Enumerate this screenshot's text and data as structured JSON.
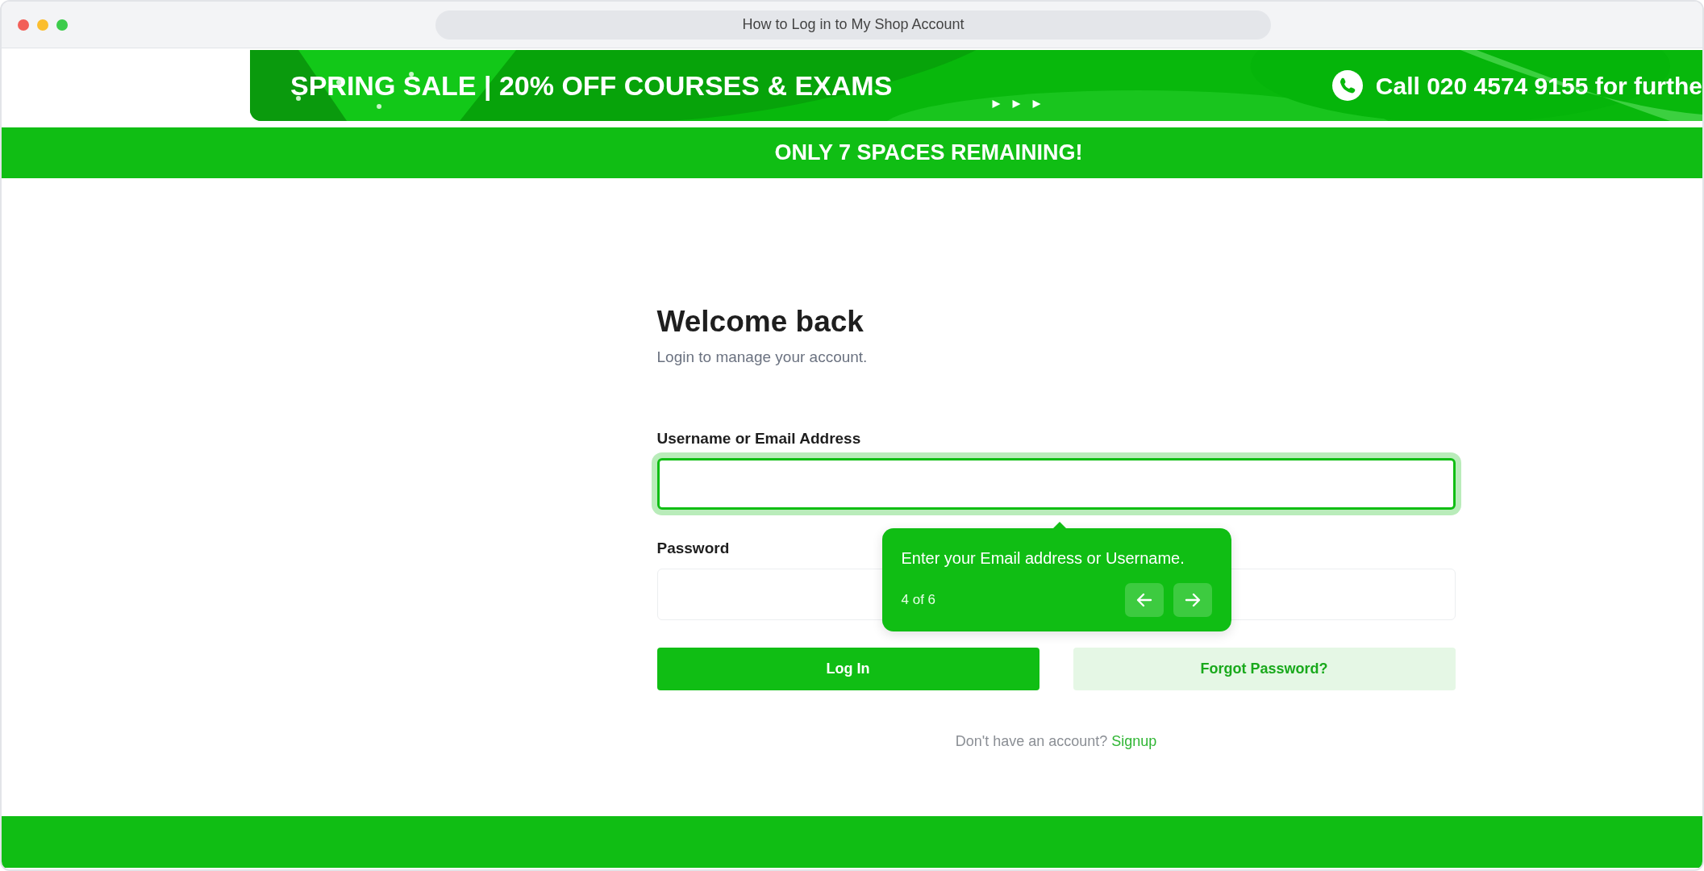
{
  "window": {
    "title": "How to Log in to My Shop Account"
  },
  "banner": {
    "headline": "SPRING SALE | 20% OFF COURSES & EXAMS",
    "phone_text": "Call 020 4574 9155 for furthe"
  },
  "notice": "ONLY 7 SPACES REMAINING!",
  "form": {
    "title": "Welcome back",
    "subtitle": "Login to manage your account.",
    "fields": [
      {
        "label": "Username or Email Address",
        "focused": true
      },
      {
        "label": "Password",
        "focused": false
      }
    ],
    "buttons": [
      {
        "label": "Log In",
        "kind": "primary"
      },
      {
        "label": "Forgot Password?",
        "kind": "soft"
      }
    ],
    "signup": {
      "text": "Don't have an account?",
      "link": "Signup"
    }
  },
  "tour_tip": {
    "text": "Enter your Email address or Username.",
    "step": "4 of 6"
  }
}
